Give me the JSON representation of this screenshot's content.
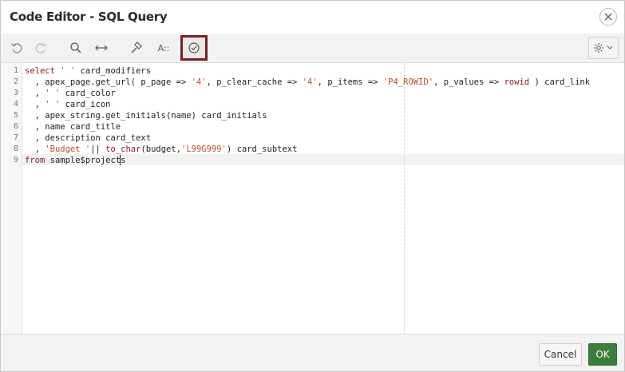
{
  "dialog": {
    "title": "Code Editor - SQL Query"
  },
  "toolbar": {
    "buttons": [
      {
        "icon": "undo-icon"
      },
      {
        "icon": "redo-icon"
      },
      {
        "icon": "search-icon"
      },
      {
        "icon": "replace-icon"
      },
      {
        "icon": "hammer-icon"
      },
      {
        "icon": "autocomplete-icon",
        "label": "A::"
      },
      {
        "icon": "validate-check-icon"
      }
    ],
    "settings_icon": "gear-icon"
  },
  "editor": {
    "line_numbers": [
      "1",
      "2",
      "3",
      "4",
      "5",
      "6",
      "7",
      "8",
      "9"
    ],
    "lines": [
      "select ' ' card_modifiers",
      "  , apex_page.get_url( p_page => '4', p_clear_cache => '4', p_items => 'P4_ROWID', p_values => rowid ) card_link",
      "  , ' ' card_color",
      "  , ' ' card_icon",
      "  , apex_string.get_initials(name) card_initials",
      "  , name card_title",
      "  , description card_text",
      "  , 'Budget '|| to_char(budget,'L99G999') card_subtext",
      "from sample$projects"
    ]
  },
  "footer": {
    "cancel_label": "Cancel",
    "ok_label": "OK"
  },
  "colors": {
    "accent_ok": "#3b7d3b",
    "highlight_border": "#7a1f1f",
    "keyword": "#8b1a1a",
    "string": "#b4532a"
  }
}
